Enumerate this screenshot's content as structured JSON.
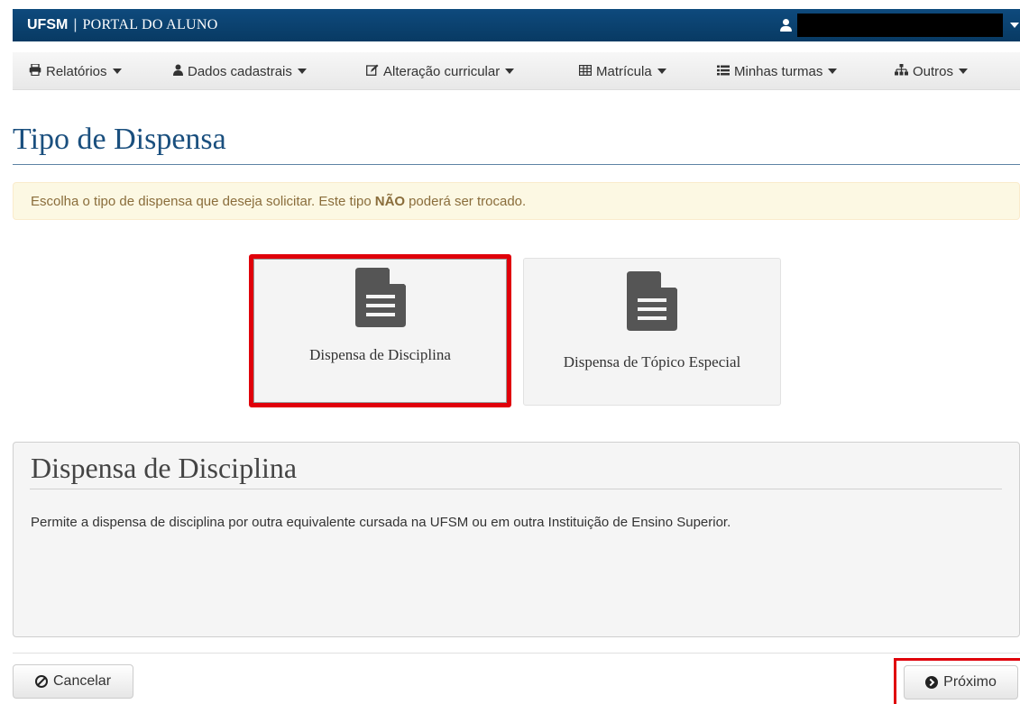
{
  "header": {
    "brand_strong": "UFSM",
    "brand_sep": "|",
    "brand_rest": "PORTAL DO ALUNO",
    "user_name": ""
  },
  "menu": {
    "items": [
      {
        "label": "Relatórios",
        "icon": "print-icon"
      },
      {
        "label": "Dados cadastrais",
        "icon": "user-icon"
      },
      {
        "label": "Alteração curricular",
        "icon": "edit-icon"
      },
      {
        "label": "Matrícula",
        "icon": "table-icon"
      },
      {
        "label": "Minhas turmas",
        "icon": "list-icon"
      },
      {
        "label": "Outros",
        "icon": "sitemap-icon"
      }
    ]
  },
  "page": {
    "title": "Tipo de Dispensa",
    "alert_before": "Escolha o tipo de dispensa que deseja solicitar. Este tipo",
    "alert_strong": "NÃO",
    "alert_after": "poderá ser trocado."
  },
  "options": [
    {
      "label": "Dispensa de Disciplina",
      "selected": true
    },
    {
      "label": "Dispensa de Tópico Especial",
      "selected": false
    }
  ],
  "description": {
    "title": "Dispensa de Disciplina",
    "text": "Permite a dispensa de disciplina por outra equivalente cursada na UFSM ou em outra Instituição de Ensino Superior."
  },
  "buttons": {
    "cancel": "Cancelar",
    "next": "Próximo"
  },
  "colors": {
    "brand": "#0b4470",
    "highlight": "#e0000a",
    "alert_bg": "#fcf8e3",
    "alert_text": "#8a6d3b"
  }
}
